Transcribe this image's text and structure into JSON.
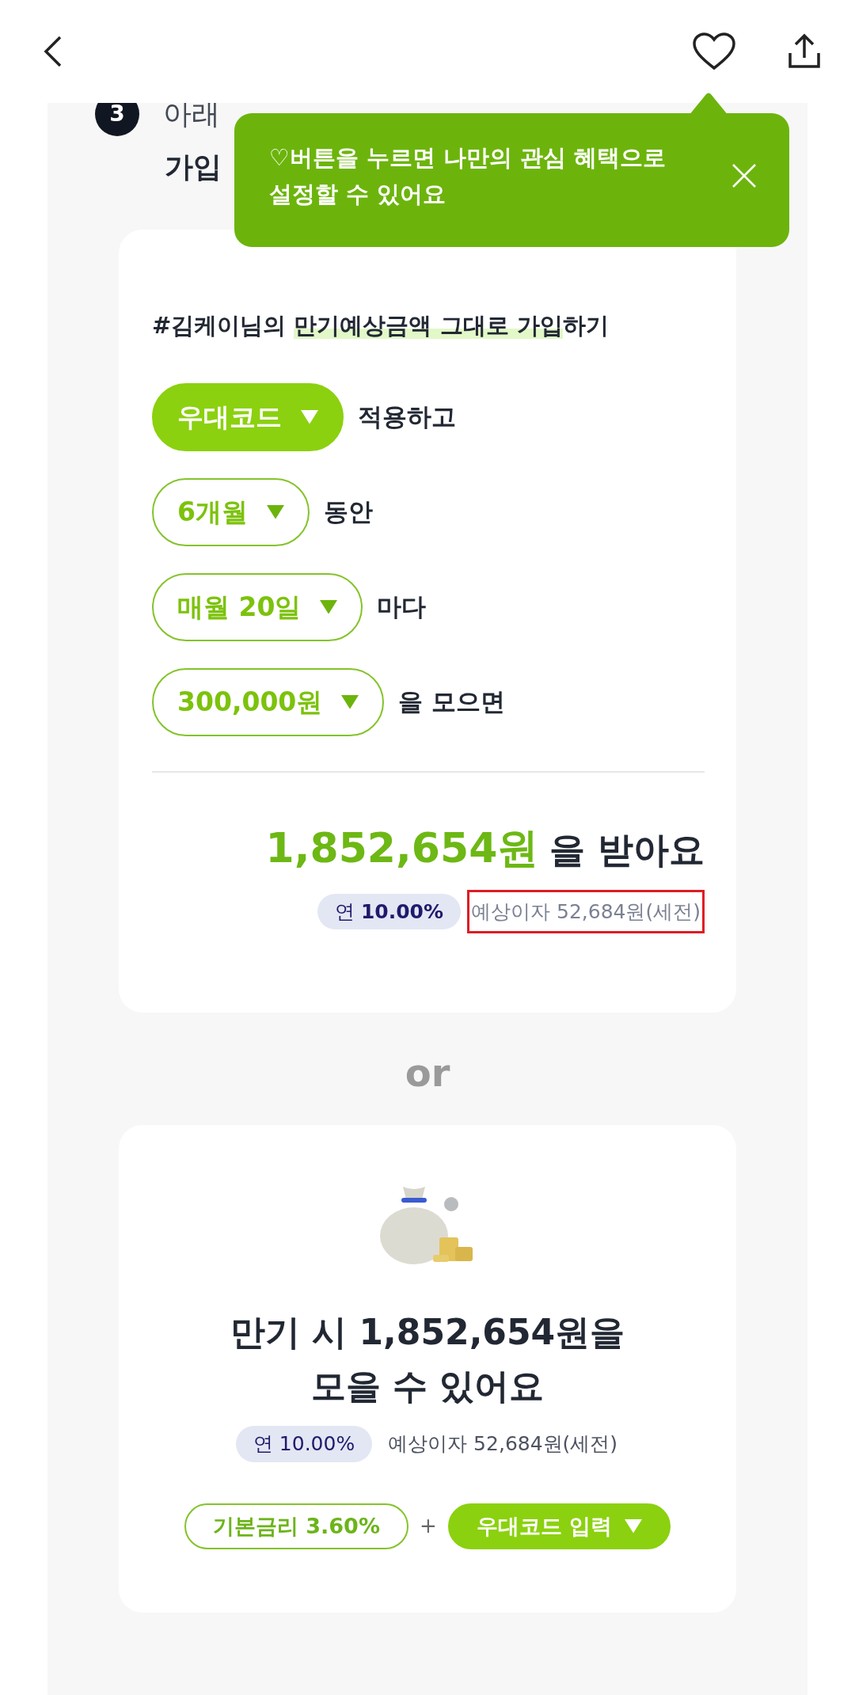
{
  "header": {
    "liked": false
  },
  "step": {
    "number": "3",
    "line_1": "아래",
    "line_2": "가입"
  },
  "tooltip": {
    "text": "♡버튼을 누르면 나만의 관심 혜택으로 설정할 수 있어요"
  },
  "plan_card": {
    "title": {
      "before": "#김케이님의 ",
      "highlight": "만기예상금액 그대로 가입",
      "after": "하기"
    },
    "options": [
      {
        "chip": "우대코드",
        "kind": "filled",
        "suffix": "적용하고"
      },
      {
        "chip": "6개월",
        "kind": "outline",
        "suffix": "동안"
      },
      {
        "chip": "매월 20일",
        "kind": "outline",
        "suffix": "마다"
      },
      {
        "chip": "300,000원",
        "kind": "outline",
        "suffix": "을 모으면"
      }
    ],
    "amount": "1,852,654원",
    "amount_suffix": "을 받아요",
    "rate": "연 **10.00%**",
    "interest": "예상이자 52,684원(세전)",
    "interest_highlighted": true
  },
  "separator": "or",
  "summary_card": {
    "title": "만기 시 1,852,654원을 모을 수 있어요",
    "rate": "연 10.00%",
    "interest": "예상이자 52,684원(세전)",
    "chips": [
      {
        "label": "기본금리 3.60%",
        "kind": "outline"
      },
      {
        "label": "우대코드 입력",
        "kind": "filled"
      }
    ],
    "joiner": "+"
  }
}
